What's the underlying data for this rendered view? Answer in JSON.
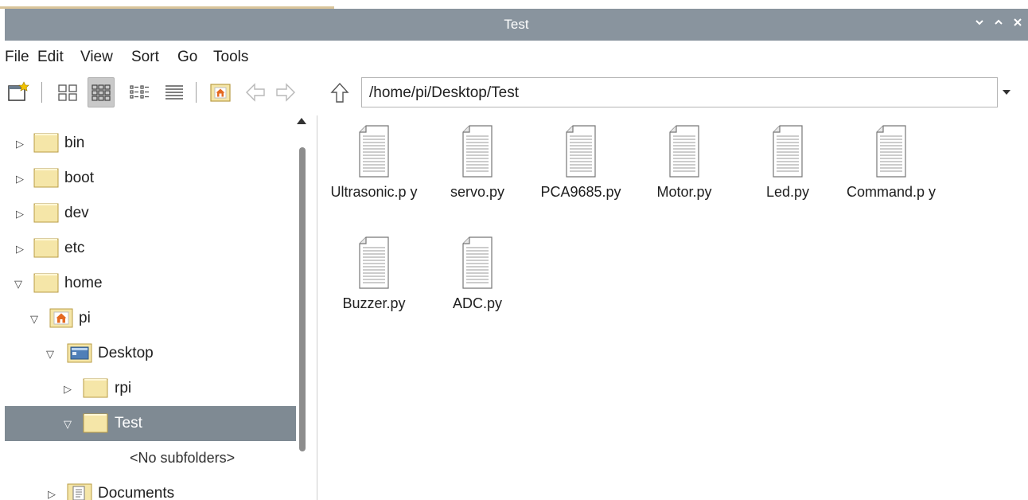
{
  "window": {
    "title": "Test",
    "controls": {
      "minimize": "⌄",
      "maximize": "⌃",
      "close": "✕"
    }
  },
  "menu": [
    "File",
    "Edit",
    "View",
    "Sort",
    "Go",
    "Tools"
  ],
  "toolbar": {
    "path": "/home/pi/Desktop/Test",
    "active_view": "icon-view"
  },
  "tree": {
    "items": [
      {
        "label": "bin",
        "expanded": false
      },
      {
        "label": "boot",
        "expanded": false
      },
      {
        "label": "dev",
        "expanded": false
      },
      {
        "label": "etc",
        "expanded": false
      },
      {
        "label": "home",
        "expanded": true
      },
      {
        "label": "pi",
        "expanded": true
      },
      {
        "label": "Desktop",
        "expanded": true
      },
      {
        "label": "rpi",
        "expanded": false
      },
      {
        "label": "Test",
        "expanded": true,
        "selected": true
      },
      {
        "label": "<No subfolders>"
      },
      {
        "label": "Documents",
        "expanded": false
      }
    ]
  },
  "files": [
    {
      "name": "Ultrasonic.p y"
    },
    {
      "name": "servo.py"
    },
    {
      "name": "PCA9685.py"
    },
    {
      "name": "Motor.py"
    },
    {
      "name": "Led.py"
    },
    {
      "name": "Command.p y"
    },
    {
      "name": "Buzzer.py"
    },
    {
      "name": "ADC.py"
    }
  ],
  "colors": {
    "titlebar": "#89949e",
    "selection": "#7f8a93",
    "folder": "#f5e6a8"
  }
}
